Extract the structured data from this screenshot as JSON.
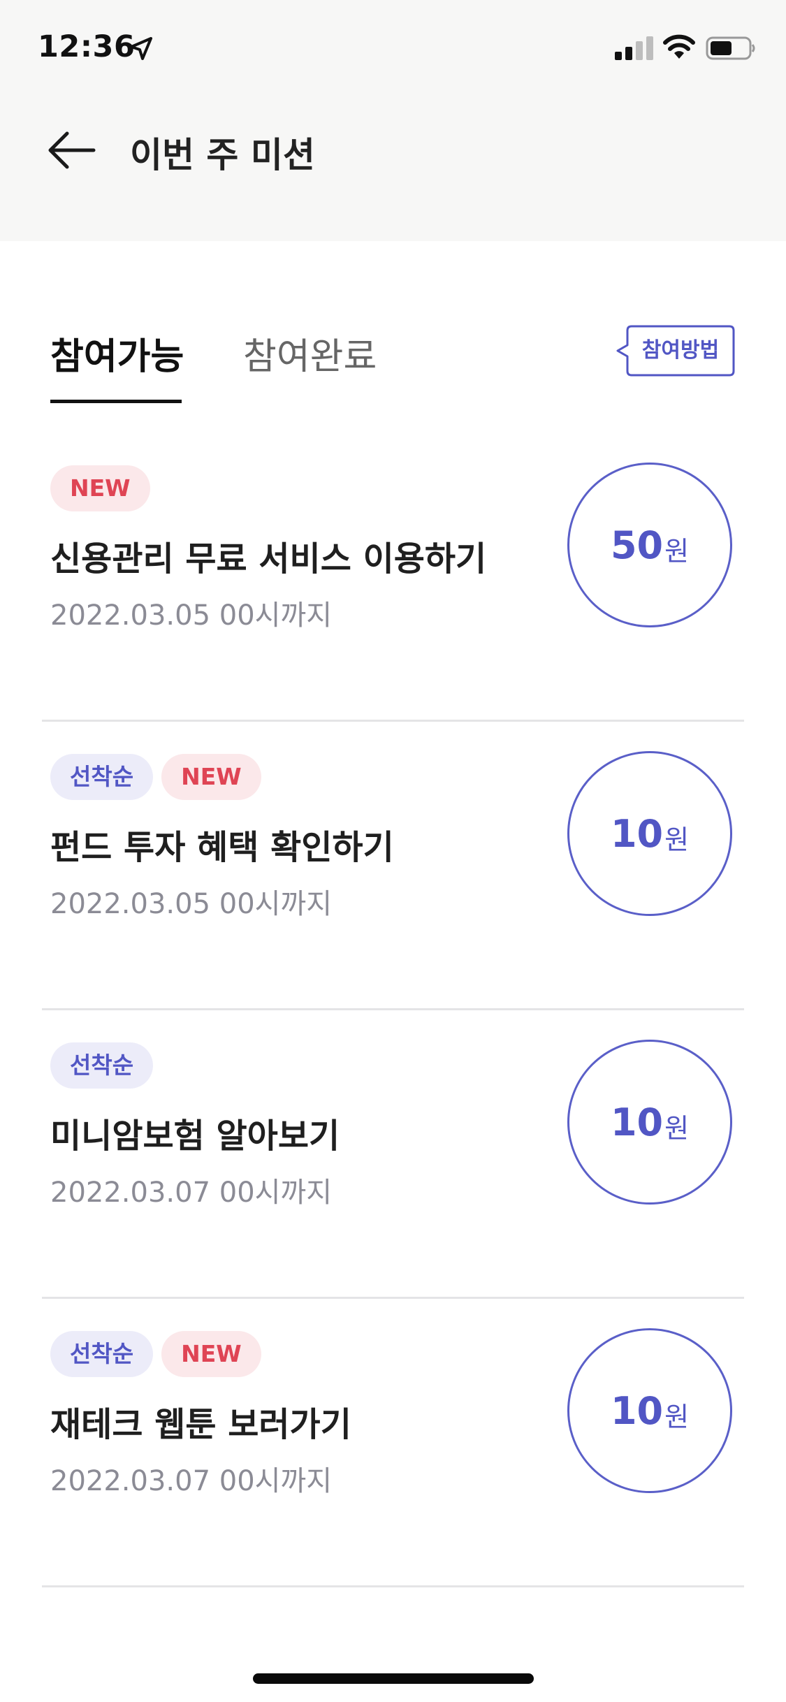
{
  "status_bar": {
    "time": "12:36",
    "location_icon": "location-arrow-icon",
    "signal_icon": "cellular-signal-icon",
    "wifi_icon": "wifi-icon",
    "battery_icon": "battery-icon"
  },
  "header": {
    "back_icon": "arrow-left-icon",
    "title": "이번 주 미션"
  },
  "tabs": [
    {
      "label": "참여가능",
      "active": true
    },
    {
      "label": "참여완료",
      "active": false
    }
  ],
  "how_to_button": {
    "label": "참여방법"
  },
  "missions": [
    {
      "badges": [
        {
          "label": "NEW",
          "type": "new"
        }
      ],
      "title": "신용관리 무료 서비스 이용하기",
      "deadline": "2022.03.05 00시까지",
      "reward_amount": "50",
      "reward_unit": "원"
    },
    {
      "badges": [
        {
          "label": "선착순",
          "type": "first"
        },
        {
          "label": "NEW",
          "type": "new"
        }
      ],
      "title": "펀드 투자 혜택 확인하기",
      "deadline": "2022.03.05 00시까지",
      "reward_amount": "10",
      "reward_unit": "원"
    },
    {
      "badges": [
        {
          "label": "선착순",
          "type": "first"
        }
      ],
      "title": "미니암보험 알아보기",
      "deadline": "2022.03.07 00시까지",
      "reward_amount": "10",
      "reward_unit": "원"
    },
    {
      "badges": [
        {
          "label": "선착순",
          "type": "first"
        },
        {
          "label": "NEW",
          "type": "new"
        }
      ],
      "title": "재테크 웹툰 보러가기",
      "deadline": "2022.03.07 00시까지",
      "reward_amount": "10",
      "reward_unit": "원"
    }
  ],
  "colors": {
    "accent": "#5156c4",
    "new_badge_text": "#df4454",
    "new_badge_bg": "#fbe8ea",
    "first_badge_bg": "#ececf9",
    "header_bg": "#f7f7f6",
    "divider": "#e4e4e6"
  }
}
